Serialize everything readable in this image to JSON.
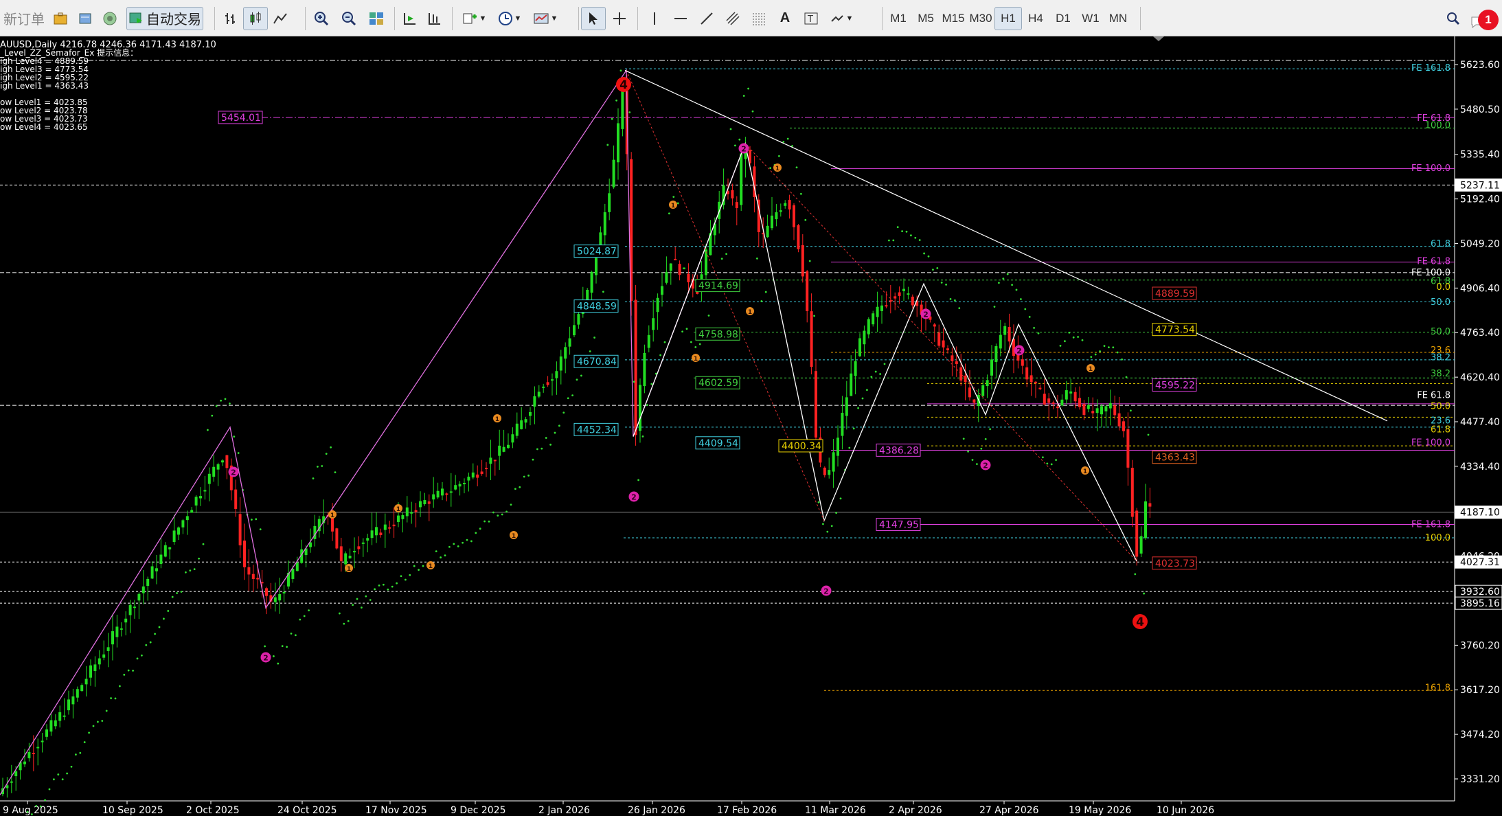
{
  "toolbar": {
    "new_order": "新订单",
    "auto_trading": "自动交易",
    "timeframes": [
      "M1",
      "M5",
      "M15",
      "M30",
      "H1",
      "H4",
      "D1",
      "W1",
      "MN"
    ],
    "active_timeframe": "H1",
    "alert_count": "1",
    "icons": [
      "briefcase-icon",
      "history-icon",
      "signal-icon",
      "bar-chart-icon",
      "candles-icon",
      "line-chart-icon",
      "zoom-in-icon",
      "zoom-out-icon",
      "tile-windows-icon",
      "autoscroll-icon",
      "chart-shift-icon",
      "indicators-icon",
      "clock-icon",
      "templates-icon",
      "cursor-icon",
      "crosshair-icon",
      "vertical-line-icon",
      "horizontal-line-icon",
      "trendline-icon",
      "channel-icon",
      "fibonacci-icon",
      "text-icon",
      "label-icon",
      "arrows-icon",
      "search-icon"
    ]
  },
  "info": {
    "symbol_line": "AUUSD,Daily  4216.78 4246.36 4171.43 4187.10",
    "indicator_name": "_Level_ZZ_Semafor_Ex 提示信息：",
    "levels": [
      "igh Level4 = 4889.59",
      "igh Level3 = 4773.54",
      "igh Level2 = 4595.22",
      "igh Level1 = 4363.43",
      "",
      "ow Level1 = 4023.85",
      "ow Level2 = 4023.78",
      "ow Level3 = 4023.73",
      "ow Level4 = 4023.65"
    ]
  },
  "price_axis": [
    "5623.60",
    "5480.50",
    "5335.40",
    "5192.40",
    "5049.20",
    "4906.40",
    "4763.40",
    "4620.40",
    "4477.40",
    "4334.40",
    "4046.20",
    "3932.60",
    "3760.20",
    "3617.20",
    "3474.20",
    "3331.20"
  ],
  "price_tags": [
    {
      "text": "5237.11",
      "bg": "#ffffff",
      "fg": "#000000"
    },
    {
      "text": "4187.10",
      "bg": "#ffffff",
      "fg": "#000000"
    },
    {
      "text": "4027.31",
      "bg": "#ffffff",
      "fg": "#000000"
    },
    {
      "text": "3932.60",
      "bg": "#000000",
      "fg": "#ffffff"
    },
    {
      "text": "3895.16",
      "bg": "#000000",
      "fg": "#ffffff"
    }
  ],
  "date_axis": [
    "9 Aug 2025",
    "10 Sep 2025",
    "2 Oct 2025",
    "24 Oct 2025",
    "17 Nov 2025",
    "9 Dec 2025",
    "2 Jan 2026",
    "26 Jan 2026",
    "17 Feb 2026",
    "11 Mar 2026",
    "2 Apr 2026",
    "27 Apr 2026",
    "19 May 2026",
    "10 Jun 2026"
  ],
  "boxes": [
    {
      "text": "5454.01",
      "color": "#e040e0"
    },
    {
      "text": "5024.87",
      "color": "#40d0e0"
    },
    {
      "text": "4848.59",
      "color": "#40d0e0"
    },
    {
      "text": "4670.84",
      "color": "#40d0e0"
    },
    {
      "text": "4452.34",
      "color": "#40d0e0"
    },
    {
      "text": "4914.69",
      "color": "#40d040"
    },
    {
      "text": "4758.98",
      "color": "#40d040"
    },
    {
      "text": "4602.59",
      "color": "#40d040"
    },
    {
      "text": "4409.54",
      "color": "#40d0e0"
    },
    {
      "text": "4400.34",
      "color": "#e8d000"
    },
    {
      "text": "4386.28",
      "color": "#e040e0"
    },
    {
      "text": "4147.95",
      "color": "#e040e0"
    },
    {
      "text": "4889.59",
      "color": "#e03030"
    },
    {
      "text": "4773.54",
      "color": "#e8d000"
    },
    {
      "text": "4595.22",
      "color": "#e040e0"
    },
    {
      "text": "4363.43",
      "color": "#e06020"
    },
    {
      "text": "4023.73",
      "color": "#e03030"
    }
  ],
  "fib_labels": [
    {
      "text": "FE 161.8",
      "color": "#40d0e0"
    },
    {
      "text": "FE 61.8",
      "color": "#e040e0"
    },
    {
      "text": "100.0",
      "color": "#40d040"
    },
    {
      "text": "FE 100.0",
      "color": "#e040e0"
    },
    {
      "text": "61.8",
      "color": "#40d0e0"
    },
    {
      "text": "FE 61.8",
      "color": "#e040e0"
    },
    {
      "text": "FE 100.0",
      "color": "#ffffff"
    },
    {
      "text": "61.8",
      "color": "#40d040"
    },
    {
      "text": "0.0",
      "color": "#e8d000"
    },
    {
      "text": "50.0",
      "color": "#40d0e0"
    },
    {
      "text": "50.0",
      "color": "#40d040"
    },
    {
      "text": "23.6",
      "color": "#e8a000"
    },
    {
      "text": "38.2",
      "color": "#40d0e0"
    },
    {
      "text": "38.2",
      "color": "#40d040"
    },
    {
      "text": "FE 61.8",
      "color": "#ffffff"
    },
    {
      "text": "50.0",
      "color": "#e8d000"
    },
    {
      "text": "23.6",
      "color": "#40d0e0"
    },
    {
      "text": "61.8",
      "color": "#e8d000"
    },
    {
      "text": "FE 100.0",
      "color": "#e040e0"
    },
    {
      "text": "FE 161.8",
      "color": "#e040e0"
    },
    {
      "text": "100.0",
      "color": "#e8d000"
    },
    {
      "text": "161.8",
      "color": "#e8a000"
    }
  ],
  "markers": {
    "major": "4",
    "minor": "2",
    "small": "1"
  }
}
